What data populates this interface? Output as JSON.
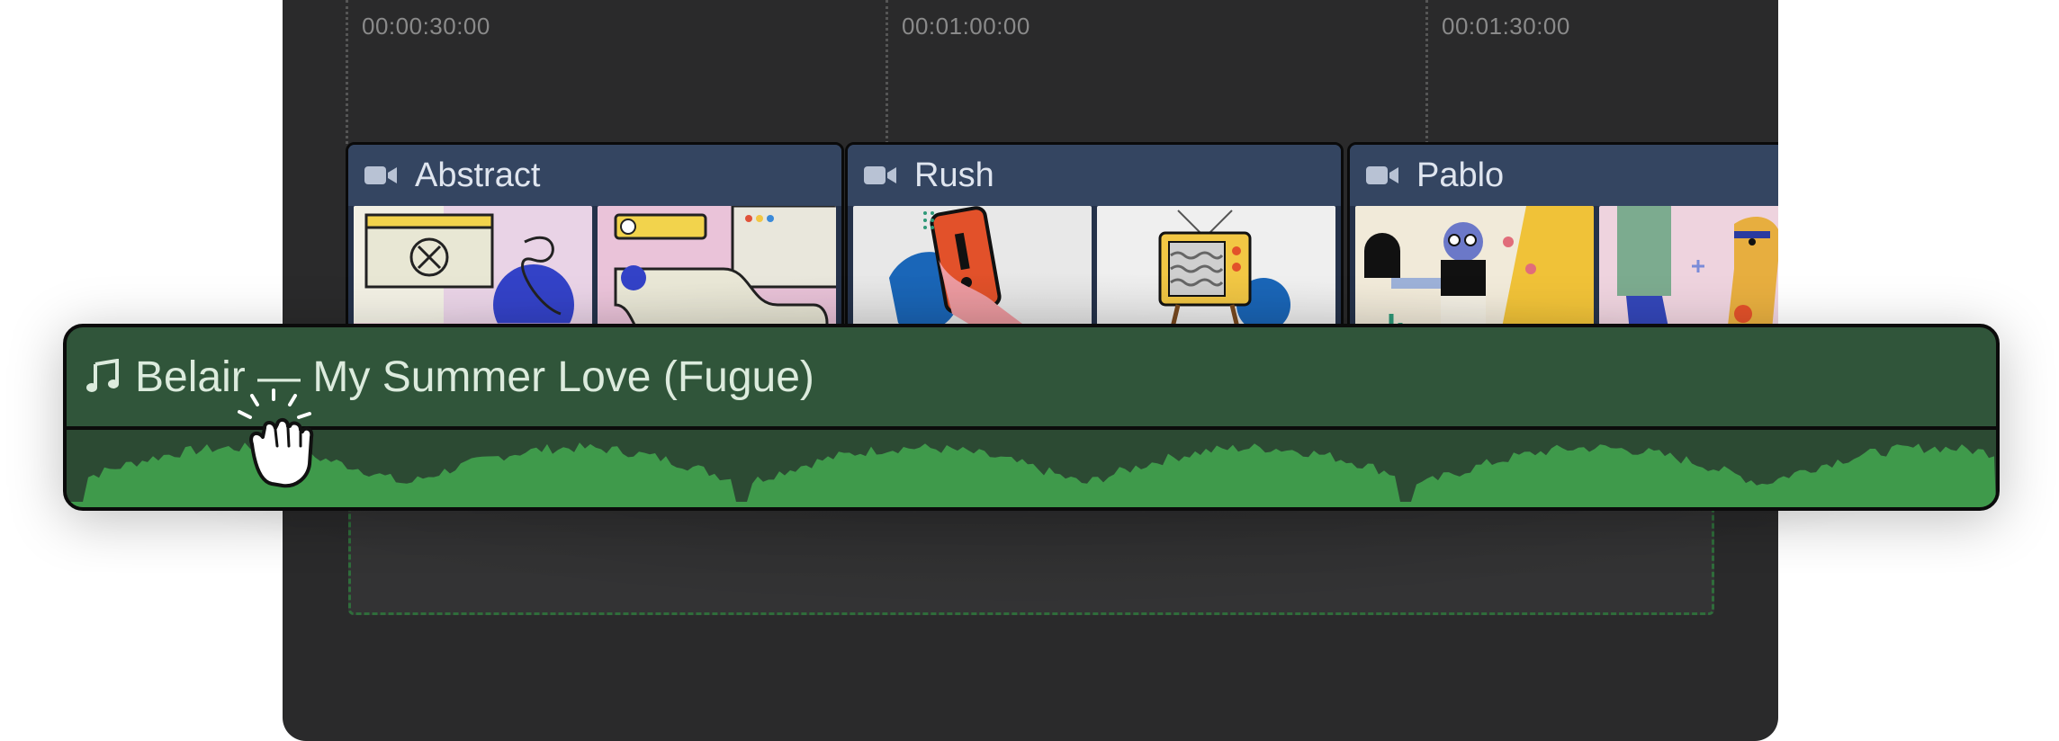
{
  "ruler": {
    "marks": [
      "00:00:30:00",
      "00:01:00:00",
      "00:01:30:00"
    ]
  },
  "video_clips": [
    {
      "title": "Abstract",
      "icon": "video-camera-icon"
    },
    {
      "title": "Rush",
      "icon": "video-camera-icon"
    },
    {
      "title": "Pablo",
      "icon": "video-camera-icon"
    }
  ],
  "audio_clip": {
    "title": "Belair — My Summer Love (Fugue)",
    "icon": "music-note-icon"
  },
  "colors": {
    "panel_bg": "#2a2a2b",
    "video_header": "#344561",
    "audio_bg": "#30553a",
    "waveform": "#3f9a4b",
    "drop_zone_border": "#2f6d3b"
  },
  "cursor": {
    "icon": "grab-hand-cursor-icon"
  }
}
